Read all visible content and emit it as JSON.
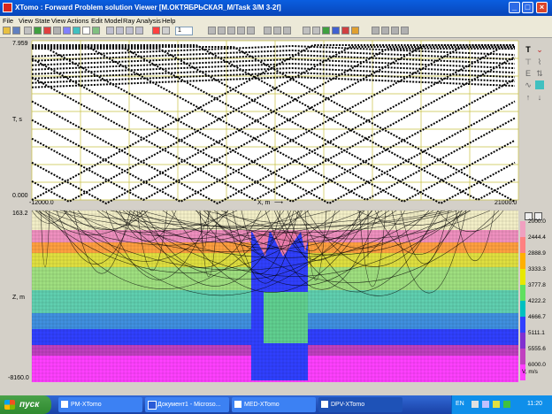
{
  "window": {
    "title": "XTomo : Forward Problem solution Viewer [M.ОКТЯБРЬСКАЯ_M/Task 3/M 3-2f]",
    "controls": [
      "_",
      "□",
      "×"
    ]
  },
  "menu": [
    "File",
    "View State",
    "View Actions",
    "Edit Model",
    "Ray Analysis",
    "Help"
  ],
  "toolbar": {
    "spin_value": "1"
  },
  "time_panel": {
    "y_max": "7.959",
    "y_min": "0.000",
    "y_label": "T, s",
    "x_min": "-12000.0",
    "x_max": "21000.0",
    "x_label": "X, m"
  },
  "model_panel": {
    "z_top": "163.2",
    "z_bottom": "-8160.0",
    "z_label": "Z, m",
    "legend_unit": "V, m/s",
    "legend": [
      "2000.0",
      "2444.4",
      "2888.9",
      "3333.3",
      "3777.8",
      "4222.2",
      "4666.7",
      "5111.1",
      "5555.6",
      "6000.0"
    ],
    "legend_colors": [
      "#f0a0c0",
      "#ff8080",
      "#ffb000",
      "#e8e800",
      "#60e060",
      "#00c0c0",
      "#3040ff",
      "#8030d0",
      "#c040c0",
      "#ff40ff"
    ]
  },
  "taskbar": {
    "start": "пуск",
    "tasks": [
      "PM-XTomo",
      "Документ1 - Microso...",
      "MED-XTomo",
      "DPV-XTomo"
    ],
    "lang": "EN",
    "time": "11:20"
  }
}
